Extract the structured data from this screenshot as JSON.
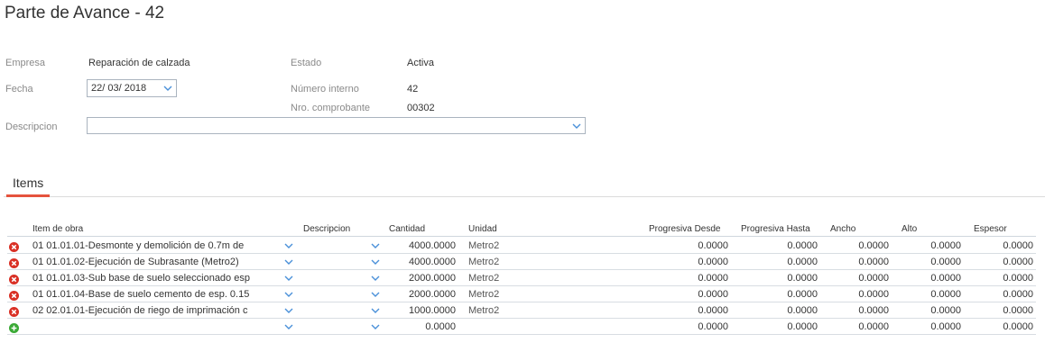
{
  "page": {
    "title": "Parte de Avance - 42"
  },
  "form": {
    "empresa_label": "Empresa",
    "empresa_value": "Reparación de calzada",
    "estado_label": "Estado",
    "estado_value": "Activa",
    "fecha_label": "Fecha",
    "fecha_value": "22/ 03/ 2018",
    "numero_interno_label": "Número interno",
    "numero_interno_value": "42",
    "nro_comprobante_label": "Nro. comprobante",
    "nro_comprobante_value": "00302",
    "descripcion_label": "Descripcion",
    "descripcion_value": ""
  },
  "tabs": [
    {
      "label": "Items",
      "active": true
    }
  ],
  "colors": {
    "accent": "#e5533d",
    "remove": "#d93025",
    "add": "#3aa935",
    "chevron": "#4a90d9"
  },
  "items": {
    "columns": {
      "item_de_obra": "Item de obra",
      "descripcion": "Descripcion",
      "cantidad": "Cantidad",
      "unidad": "Unidad",
      "progresiva_desde": "Progresiva Desde",
      "progresiva_hasta": "Progresiva Hasta",
      "ancho": "Ancho",
      "alto": "Alto",
      "espesor": "Espesor"
    },
    "rows": [
      {
        "icon": "remove-icon",
        "item": "01 01.01.01-Desmonte y demolición de 0.7m de",
        "descripcion": "",
        "cantidad": "4000.0000",
        "unidad": "Metro2",
        "desde": "0.0000",
        "hasta": "0.0000",
        "ancho": "0.0000",
        "alto": "0.0000",
        "espesor": "0.0000"
      },
      {
        "icon": "remove-icon",
        "item": "01 01.01.02-Ejecución de Subrasante (Metro2)",
        "descripcion": "",
        "cantidad": "4000.0000",
        "unidad": "Metro2",
        "desde": "0.0000",
        "hasta": "0.0000",
        "ancho": "0.0000",
        "alto": "0.0000",
        "espesor": "0.0000"
      },
      {
        "icon": "remove-icon",
        "item": "01 01.01.03-Sub base de suelo seleccionado esp",
        "descripcion": "",
        "cantidad": "2000.0000",
        "unidad": "Metro2",
        "desde": "0.0000",
        "hasta": "0.0000",
        "ancho": "0.0000",
        "alto": "0.0000",
        "espesor": "0.0000"
      },
      {
        "icon": "remove-icon",
        "item": "01 01.01.04-Base de suelo cemento de esp. 0.15",
        "descripcion": "",
        "cantidad": "2000.0000",
        "unidad": "Metro2",
        "desde": "0.0000",
        "hasta": "0.0000",
        "ancho": "0.0000",
        "alto": "0.0000",
        "espesor": "0.0000"
      },
      {
        "icon": "remove-icon",
        "item": "02 02.01.01-Ejecución de riego de imprimación c",
        "descripcion": "",
        "cantidad": "1000.0000",
        "unidad": "Metro2",
        "desde": "0.0000",
        "hasta": "0.0000",
        "ancho": "0.0000",
        "alto": "0.0000",
        "espesor": "0.0000"
      },
      {
        "icon": "add-icon",
        "item": "",
        "descripcion": "",
        "cantidad": "0.0000",
        "unidad": "",
        "desde": "0.0000",
        "hasta": "0.0000",
        "ancho": "0.0000",
        "alto": "0.0000",
        "espesor": "0.0000"
      }
    ]
  }
}
